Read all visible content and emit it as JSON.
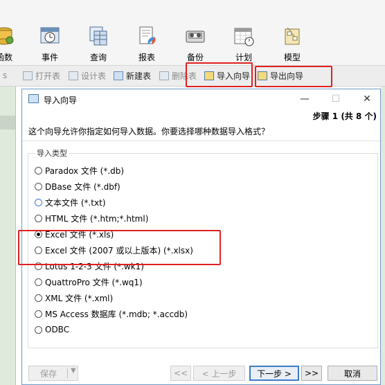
{
  "ribbon": {
    "items": [
      {
        "label": "函数",
        "icon": "function-icon"
      },
      {
        "label": "事件",
        "icon": "event-clock-icon"
      },
      {
        "label": "查询",
        "icon": "query-table-icon"
      },
      {
        "label": "报表",
        "icon": "report-icon"
      },
      {
        "label": "备份",
        "icon": "backup-tape-icon"
      },
      {
        "label": "计划",
        "icon": "schedule-calendar-icon"
      },
      {
        "label": "模型",
        "icon": "model-icon"
      }
    ]
  },
  "subtoolbar": {
    "open_table": "打开表",
    "design_table": "设计表",
    "new_table": "新建表",
    "delete_table": "删除表",
    "import_wizard": "导入向导",
    "export_wizard": "导出向导"
  },
  "dialog": {
    "title": "导入向导",
    "minimize": "—",
    "maximize": "☐",
    "close": "✕",
    "step": "步骤 1 (共 8 个)",
    "prompt": "这个向导允许你指定如何导入数据。你要选择哪种数据导入格式？",
    "group_title": "导入类型",
    "options": [
      "Paradox 文件 (*.db)",
      "DBase 文件 (*.dbf)",
      "文本文件 (*.txt)",
      "HTML 文件 (*.htm;*.html)",
      "Excel 文件 (*.xls)",
      "Excel 文件 (2007 或以上版本) (*.xlsx)",
      "Lotus 1-2-3 文件 (*.wk1)",
      "QuattroPro 文件 (*.wq1)",
      "XML 文件 (*.xml)",
      "MS Access 数据库 (*.mdb; *.accdb)",
      "ODBC"
    ],
    "selected_option": "Excel 文件 (*.xls)",
    "buttons": {
      "save": "保存",
      "first": "<<",
      "prev": "< 上一步",
      "next": "下一步 >",
      "last": ">>",
      "cancel": "取消"
    }
  },
  "colors": {
    "annotation_red": "#e02020",
    "accent_blue": "#3a7dc9",
    "left_pane_green": "#dfeadd"
  }
}
